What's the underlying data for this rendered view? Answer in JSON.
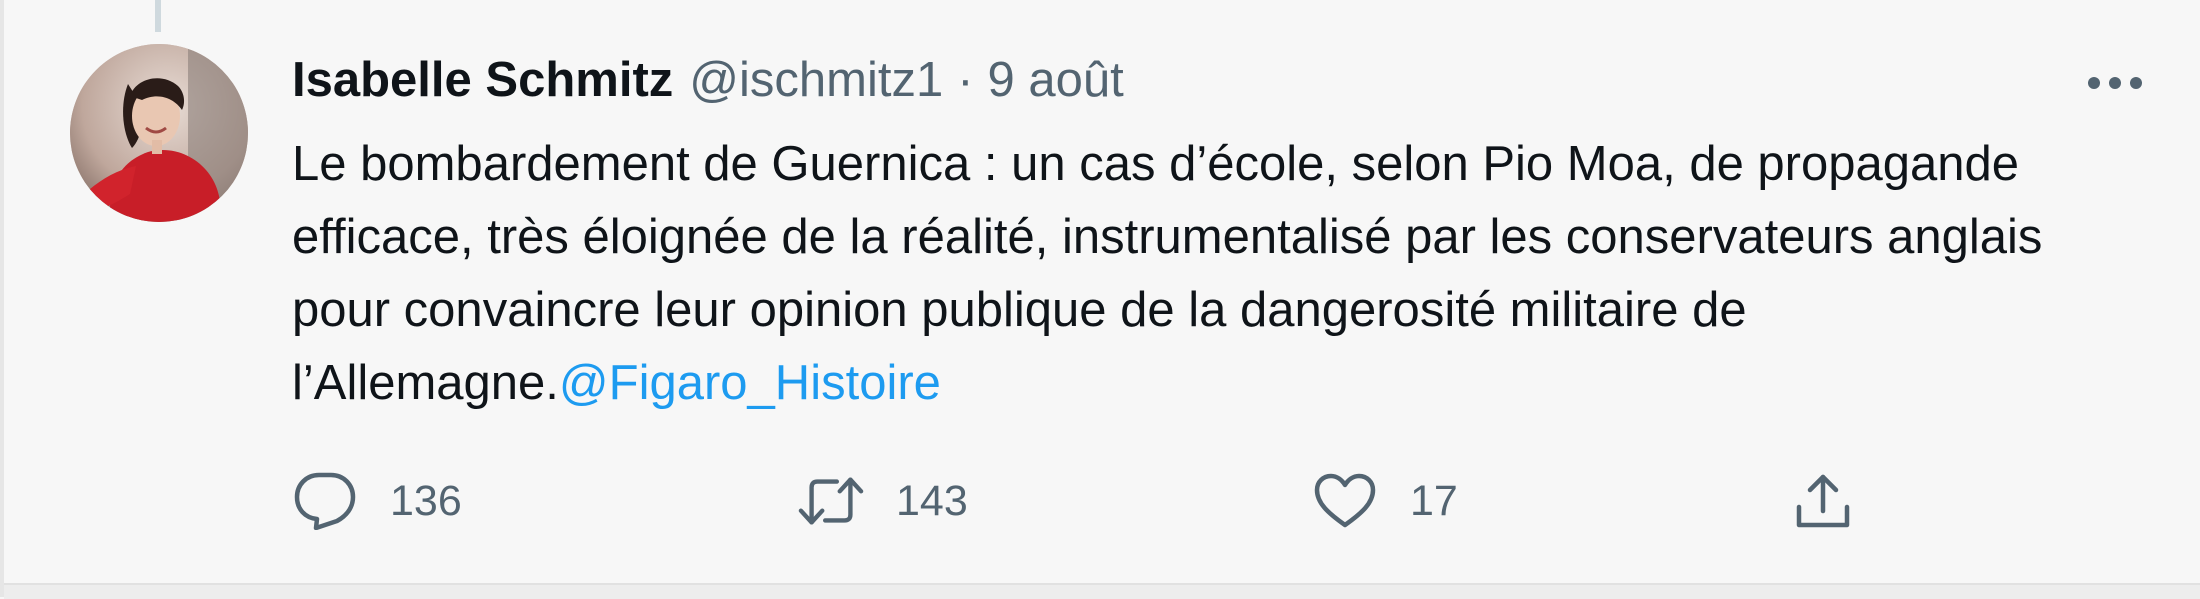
{
  "tweet": {
    "author": {
      "display_name": "Isabelle Schmitz",
      "handle": "@ischmitz1"
    },
    "separator": "·",
    "date": "9 août",
    "text": "Le bombardement de Guernica : un cas d’école, selon Pio Moa, de propagande efficace, très éloignée de la réalité, instrumentalisé par les conservateurs anglais pour convaincre leur opinion publique de la dangerosité militaire de l’Allemagne.",
    "mention": "@Figaro_Histoire",
    "actions": {
      "reply_count": "136",
      "retweet_count": "143",
      "like_count": "17"
    }
  },
  "colors": {
    "background": "#f7f7f7",
    "text": "#0f1419",
    "secondary_text": "#536471",
    "link": "#1d9bf0"
  },
  "icons": {
    "more": "more-horizontal-icon",
    "reply": "reply-icon",
    "retweet": "retweet-icon",
    "like": "heart-icon",
    "share": "share-icon"
  }
}
